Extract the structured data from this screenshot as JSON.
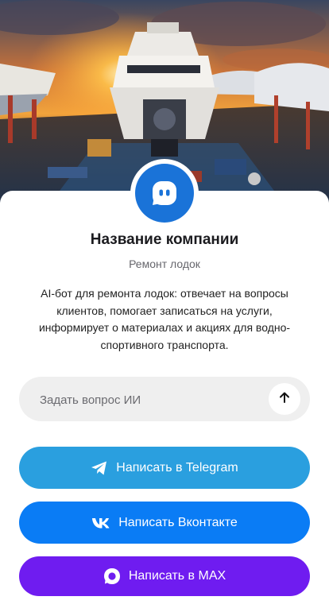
{
  "hero": {
    "image": "boat-repair-yard-sunset-photo",
    "colors": {
      "sky_top": "#3a4660",
      "sun": "#ffb640",
      "deck": "#3b2a20"
    }
  },
  "profile": {
    "avatar_icon": "chat-bot-icon",
    "accent": "#1a73d8",
    "company_name": "Название компании",
    "category": "Ремонт лодок",
    "description": "AI-бот для ремонта лодок: отвечает на вопросы клиентов, помогает записаться на услуги, информирует о материалах и акциях для водно-спортивного транспорта."
  },
  "ask": {
    "placeholder": "Задать вопрос ИИ",
    "send_icon": "arrow-up-icon"
  },
  "buttons": [
    {
      "label": "Написать в Telegram",
      "icon": "telegram-icon",
      "color": "#2a9fdf"
    },
    {
      "label": "Написать Вконтакте",
      "icon": "vk-icon",
      "color": "#0a7cf5"
    },
    {
      "label": "Написать в MAX",
      "icon": "max-icon",
      "color": "#6f1cf0"
    }
  ]
}
